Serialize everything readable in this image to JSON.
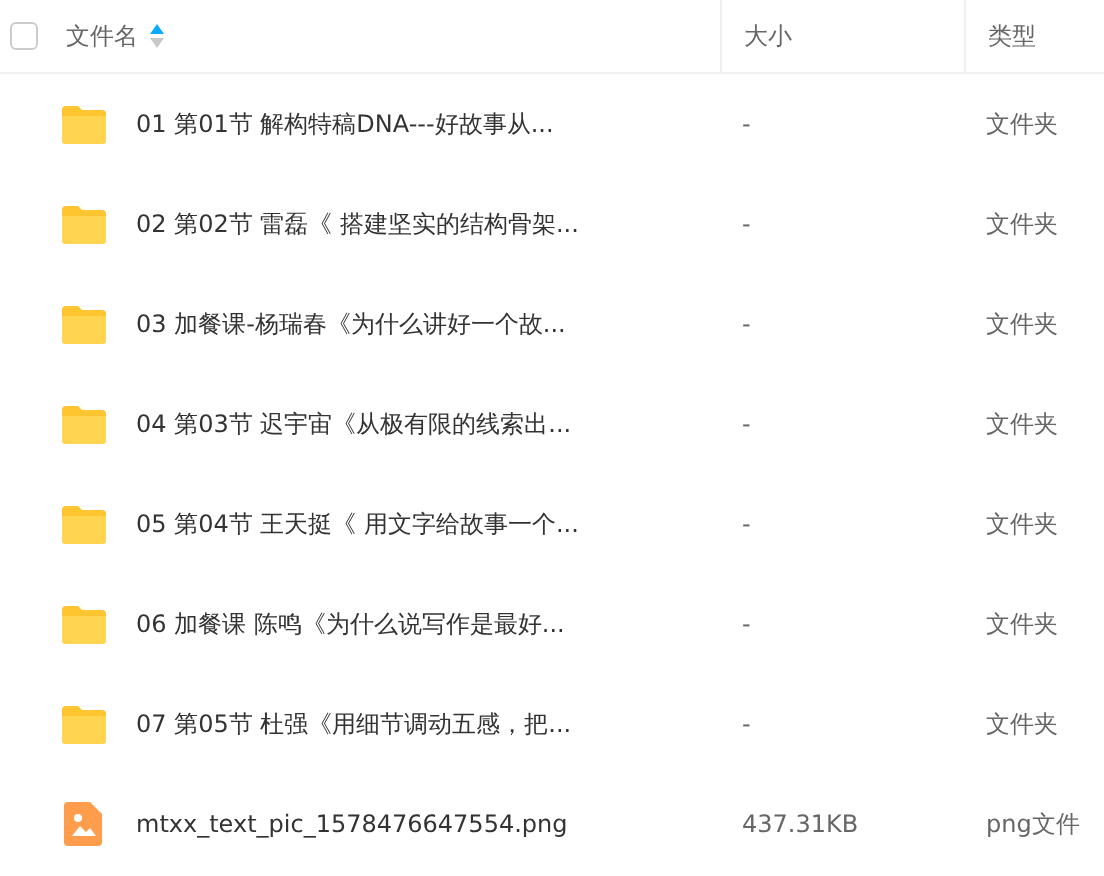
{
  "header": {
    "select_all": {
      "checked": false
    },
    "columns": [
      {
        "label": "文件名",
        "sorted": true
      },
      {
        "label": "大小",
        "sorted": false
      },
      {
        "label": "类型",
        "sorted": false
      }
    ]
  },
  "rows": [
    {
      "kind": "folder",
      "name": "01 第01节 解构特稿DNA---好故事从...",
      "size": "-",
      "type": "文件夹"
    },
    {
      "kind": "folder",
      "name": "02 第02节 雷磊《 搭建坚实的结构骨架...",
      "size": "-",
      "type": "文件夹"
    },
    {
      "kind": "folder",
      "name": "03 加餐课-杨瑞春《为什么讲好一个故...",
      "size": "-",
      "type": "文件夹"
    },
    {
      "kind": "folder",
      "name": "04 第03节 迟宇宙《从极有限的线索出...",
      "size": "-",
      "type": "文件夹"
    },
    {
      "kind": "folder",
      "name": "05 第04节 王天挺《 用文字给故事一个...",
      "size": "-",
      "type": "文件夹"
    },
    {
      "kind": "folder",
      "name": "06 加餐课 陈鸣《为什么说写作是最好...",
      "size": "-",
      "type": "文件夹"
    },
    {
      "kind": "folder",
      "name": "07 第05节 杜强《用细节调动五感，把...",
      "size": "-",
      "type": "文件夹"
    },
    {
      "kind": "image",
      "name": "mtxx_text_pic_1578476647554.png",
      "size": "437.31KB",
      "type": "png文件"
    }
  ]
}
